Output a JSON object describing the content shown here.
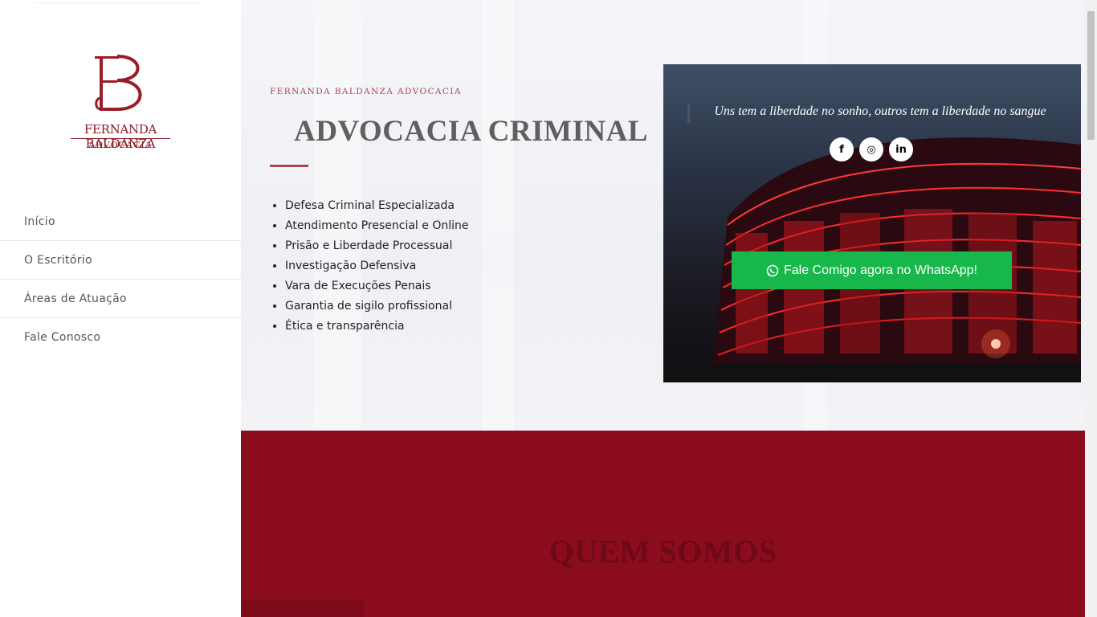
{
  "logo": {
    "monogram": "FB",
    "name": "FERNANDA BALDANZA",
    "sub": "ADVOCACIA"
  },
  "nav": [
    {
      "label": "Início"
    },
    {
      "label": "O Escritório"
    },
    {
      "label": "Áreas de Atuação"
    },
    {
      "label": "Fale Conosco"
    }
  ],
  "hero": {
    "eyebrow": "FERNANDA BALDANZA ADVOCACIA",
    "title": "ADVOCACIA CRIMINAL",
    "features": [
      "Defesa Criminal Especializada",
      "Atendimento Presencial e Online",
      "Prisão e Liberdade Processual",
      "Investigação Defensiva",
      "Vara de Execuções Penais",
      "Garantia de sigilo profissional",
      "Ética e transparência"
    ]
  },
  "card": {
    "quote": "Uns tem a liberdade no sonho, outros tem a liberdade no sangue",
    "socials": [
      {
        "icon": "facebook-icon",
        "glyph": "f"
      },
      {
        "icon": "instagram-icon",
        "glyph": "◎"
      },
      {
        "icon": "linkedin-icon",
        "glyph": "in"
      }
    ],
    "whatsapp_label": "Fale Comigo agora no WhatsApp!"
  },
  "section": {
    "title": "QUEM SOMOS"
  },
  "colors": {
    "brand": "#8a0c1d",
    "accent": "#a8434f",
    "whatsapp": "#18b74b"
  }
}
